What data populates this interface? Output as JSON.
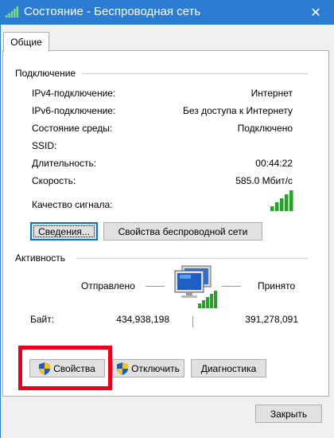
{
  "window": {
    "title": "Состояние - Беспроводная сеть",
    "close_glyph": "✕"
  },
  "tabs": [
    {
      "label": "Общие"
    }
  ],
  "connection": {
    "section_title": "Подключение",
    "rows": [
      {
        "label": "IPv4-подключение:",
        "value": "Интернет"
      },
      {
        "label": "IPv6-подключение:",
        "value": "Без доступа к Интернету"
      },
      {
        "label": "Состояние среды:",
        "value": "Подключено"
      },
      {
        "label": "SSID:",
        "value": ""
      },
      {
        "label": "Длительность:",
        "value": "00:44:22"
      },
      {
        "label": "Скорость:",
        "value": "585.0 Мбит/с"
      }
    ],
    "signal_label": "Качество сигнала:",
    "signal_bars_of_5": 5,
    "details_button": "Сведения...",
    "wireless_props_button": "Свойства беспроводной сети"
  },
  "activity": {
    "section_title": "Активность",
    "sent_label": "Отправлено",
    "received_label": "Принято",
    "bytes_label": "Байт:",
    "bytes_sent": "434,938,198",
    "bytes_received": "391,278,091",
    "activity_icon": "network-computers-icon"
  },
  "actions": {
    "properties_button": "Свойства",
    "disable_button": "Отключить",
    "diagnose_button": "Диагностика"
  },
  "footer": {
    "close_button": "Закрыть"
  },
  "colors": {
    "titlebar": "#2b7cd3",
    "signal_green": "#2aa02a",
    "highlight": "#e8001c",
    "primary_button_border": "#0078d7"
  }
}
